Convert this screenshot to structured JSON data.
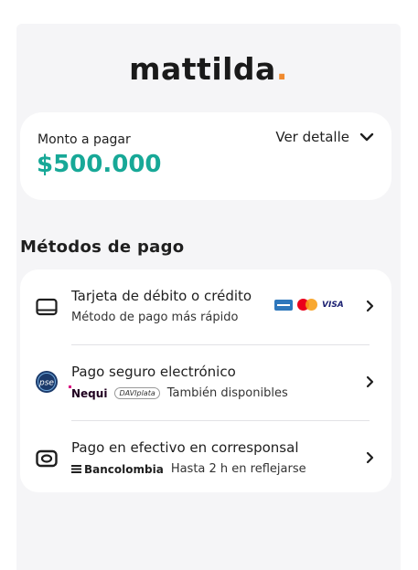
{
  "brand": {
    "name": "mattilda",
    "dot": "."
  },
  "amount": {
    "label": "Monto a pagar",
    "value": "$500.000",
    "detail_label": "Ver detalle"
  },
  "methods_title": "Métodos de pago",
  "methods": [
    {
      "title": "Tarjeta de débito o crédito",
      "subtitle": "Método de pago más rápido",
      "brands": [
        "amex",
        "mastercard",
        "VISA"
      ]
    },
    {
      "title": "Pago seguro electrónico",
      "subtitle": "También disponibles",
      "partners": [
        "Nequi",
        "DAVIplata"
      ],
      "icon_text": "pse"
    },
    {
      "title": "Pago en efectivo en corresponsal",
      "subtitle": "Hasta 2 h en reflejarse",
      "partner": "Bancolombia"
    }
  ],
  "colors": {
    "accent": "#17a897",
    "brand_dot": "#f08a2e",
    "background": "#f5f5f7"
  },
  "icons": [
    "card-icon",
    "pse-icon",
    "cash-icon",
    "chevron-down-icon",
    "chevron-right-icon"
  ]
}
